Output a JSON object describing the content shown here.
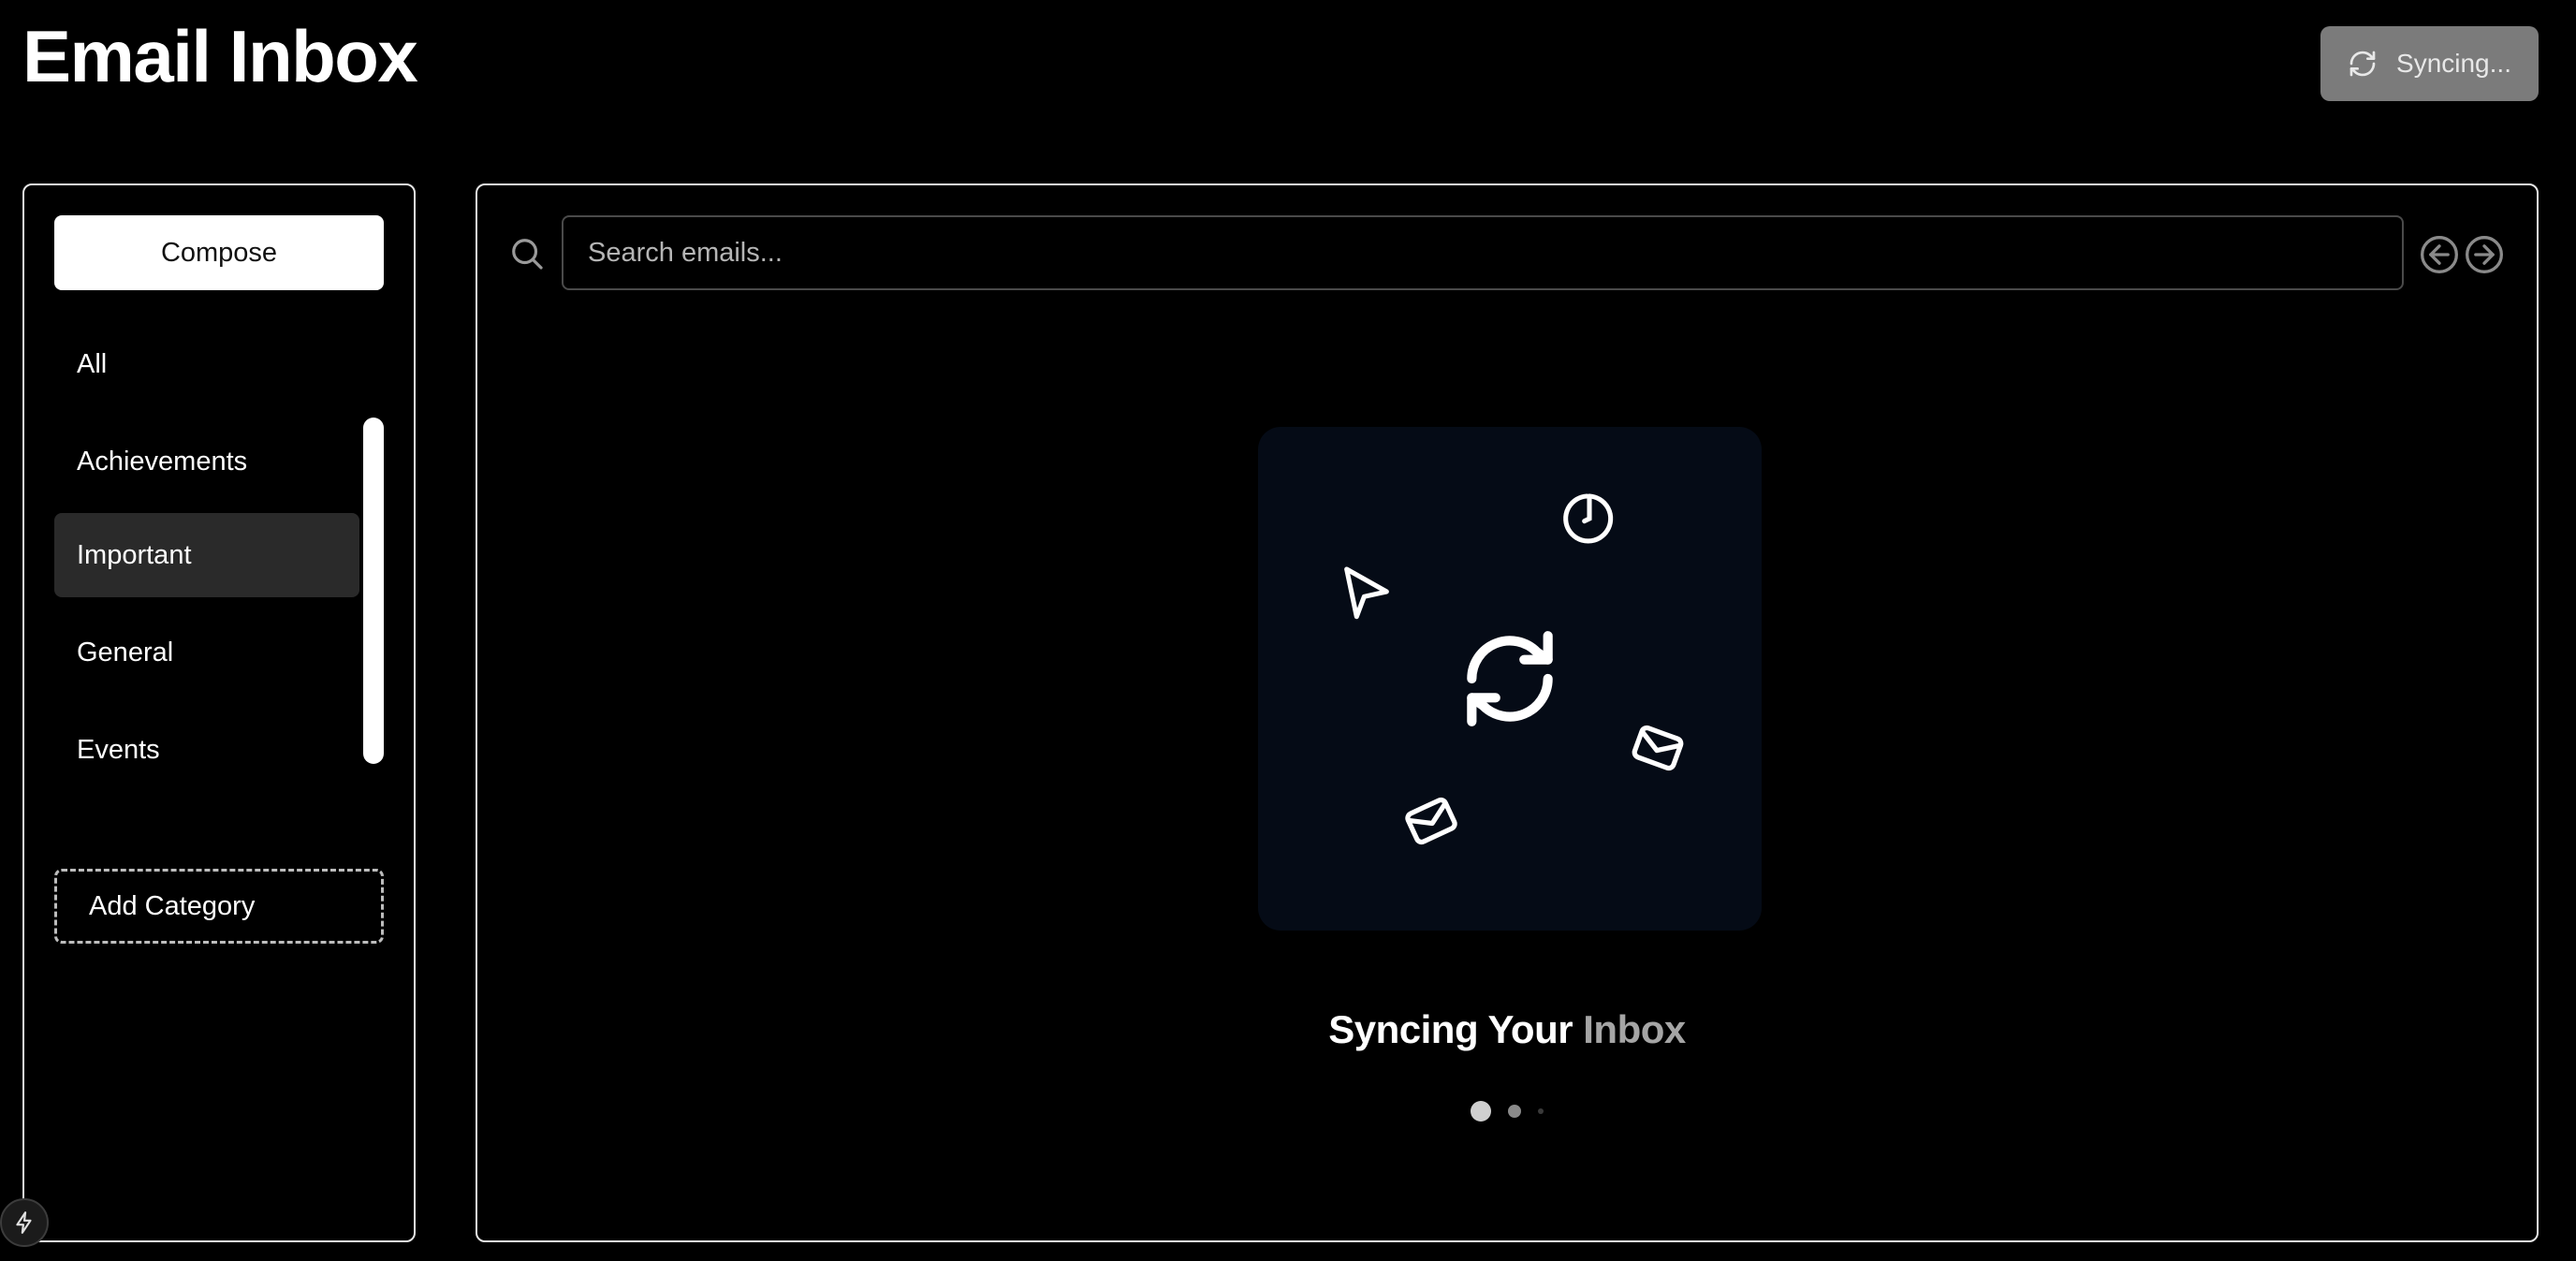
{
  "header": {
    "title": "Email Inbox",
    "sync_button_label": "Syncing...",
    "sync_button_icon": "refresh-icon"
  },
  "sidebar": {
    "compose_label": "Compose",
    "categories": [
      {
        "label": "All",
        "active": false
      },
      {
        "label": "Achievements",
        "active": false
      },
      {
        "label": "Important",
        "active": true
      },
      {
        "label": "General",
        "active": false
      },
      {
        "label": "Events",
        "active": false
      }
    ],
    "add_category_label": "Add Category"
  },
  "main": {
    "search": {
      "placeholder": "Search emails...",
      "value": "",
      "icon": "search-icon"
    },
    "nav": {
      "prev_icon": "arrow-left-circle-icon",
      "next_icon": "arrow-right-circle-icon"
    },
    "sync_state": {
      "heading_part_a": "Syncing Your",
      "heading_part_b": " Inbox",
      "icons": [
        "send-icon",
        "timer-icon",
        "refresh-icon",
        "mail-icon",
        "mail-icon"
      ],
      "step_dots": 3,
      "active_step": 1
    }
  },
  "colors": {
    "background": "#000000",
    "panel_border": "#e6e6e6",
    "sync_button_bg": "#7b7b7b",
    "active_category_bg": "#2a2a2a",
    "card_bg": "#050b16"
  },
  "dev_badge_icon": "lightning-icon"
}
